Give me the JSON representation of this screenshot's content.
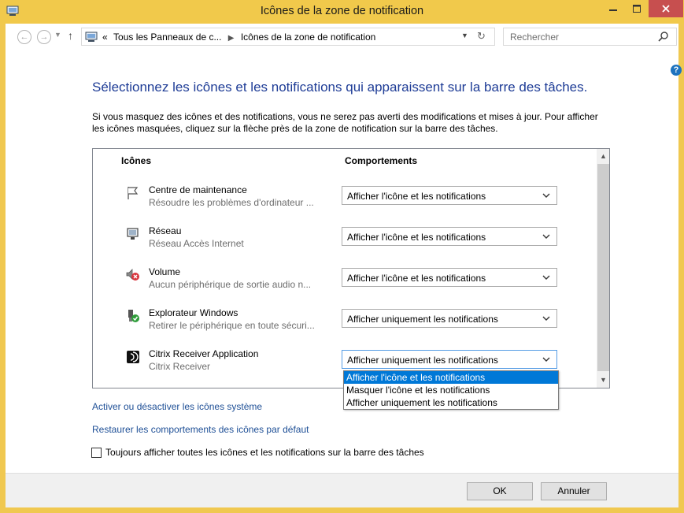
{
  "window": {
    "title": "Icônes de la zone de notification"
  },
  "address": {
    "crumb_prefix": "«",
    "crumbs": [
      "Tous les Panneaux de c...",
      "Icônes de la zone de notification"
    ],
    "search_placeholder": "Rechercher"
  },
  "main": {
    "heading": "Sélectionnez les icônes et les notifications qui apparaissent sur la barre des tâches.",
    "description": "Si vous masquez des icônes et des notifications, vous ne serez pas averti des modifications et mises à jour. Pour afficher les icônes masquées, cliquez sur la flèche près de la zone de notification sur la barre des tâches."
  },
  "table": {
    "headers": {
      "icons": "Icônes",
      "behaviors": "Comportements"
    },
    "rows": [
      {
        "name": "Centre de maintenance",
        "desc": "Résoudre les problèmes d'ordinateur ...",
        "behavior": "Afficher l'icône et les notifications",
        "icon": "flag-icon"
      },
      {
        "name": "Réseau",
        "desc": "Réseau Accès Internet",
        "behavior": "Afficher l'icône et les notifications",
        "icon": "network-icon"
      },
      {
        "name": "Volume",
        "desc": "Aucun périphérique de sortie audio n...",
        "behavior": "Afficher l'icône et les notifications",
        "icon": "volume-muted-icon"
      },
      {
        "name": "Explorateur Windows",
        "desc": "Retirer le périphérique en toute sécuri...",
        "behavior": "Afficher uniquement les notifications",
        "icon": "usb-safely-remove-icon"
      },
      {
        "name": "Citrix Receiver Application",
        "desc": "Citrix Receiver",
        "behavior": "Afficher uniquement les notifications",
        "icon": "citrix-icon"
      }
    ]
  },
  "dropdown": {
    "options": [
      "Afficher l'icône et les notifications",
      "Masquer l'icône et les notifications",
      "Afficher uniquement les notifications"
    ],
    "highlighted_index": 0
  },
  "links": {
    "system_icons": "Activer ou désactiver les icônes système",
    "restore_defaults": "Restaurer les comportements des icônes par défaut"
  },
  "checkbox": {
    "label": "Toujours afficher toutes les icônes et les notifications sur la barre des tâches",
    "checked": false
  },
  "buttons": {
    "ok": "OK",
    "cancel": "Annuler"
  },
  "colors": {
    "titlebar": "#f1c94b",
    "close": "#c74f4f",
    "heading": "#1e3c96",
    "link": "#1e4f96",
    "selection": "#0078d7"
  }
}
